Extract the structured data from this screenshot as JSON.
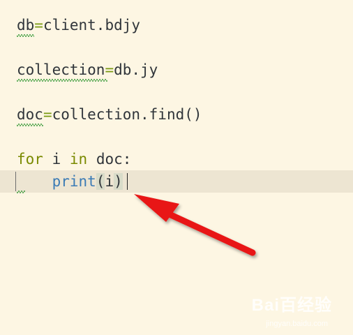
{
  "editor": {
    "lines": [
      {
        "var": "db",
        "op": "=",
        "rest": "client.bdjy"
      },
      {
        "var": "collection",
        "op": "=",
        "rest": "db.jy"
      },
      {
        "var": "doc",
        "op": "=",
        "rest": "collection.find()"
      },
      {
        "kw1": "for",
        "mid1": " i ",
        "kw2": "in",
        "mid2": " doc:"
      },
      {
        "indent": "    ",
        "fn": "print",
        "open": "(",
        "arg": "i",
        "close": ")"
      }
    ]
  },
  "watermark": {
    "text": "Bai百经验",
    "sub": "jingyan.baidu.com"
  },
  "colors": {
    "background": "#fdf6e3",
    "current_line": "#ede5d2",
    "keyword": "#7a8a00",
    "function": "#3b7bb5",
    "operator": "#7a9a12",
    "arrow": "#e81818"
  }
}
